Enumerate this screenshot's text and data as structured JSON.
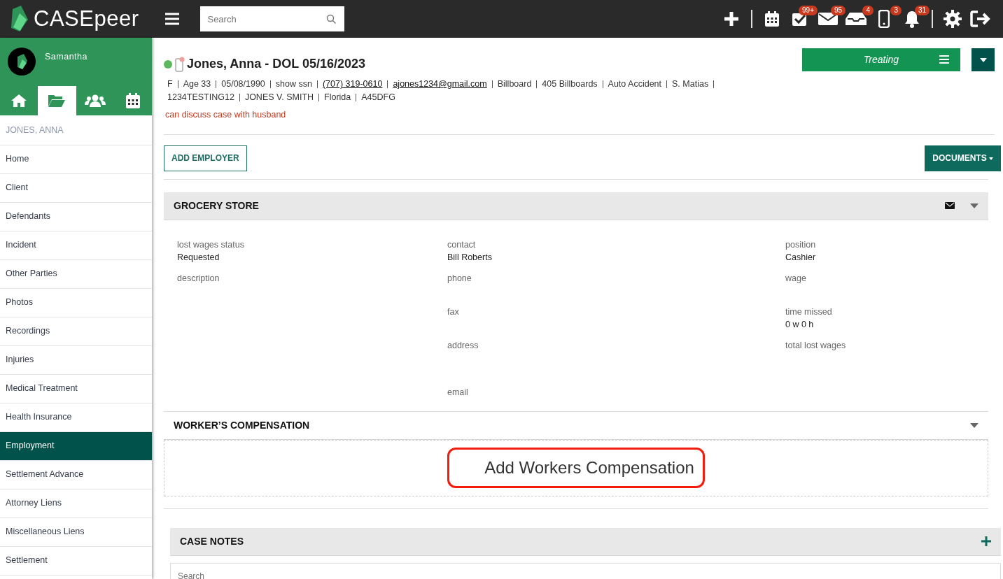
{
  "topbar": {
    "logo_text": "CASEpeer",
    "search_placeholder": "Search",
    "icons": [
      {
        "kind": "plus"
      },
      {
        "kind": "separator"
      },
      {
        "kind": "calendar"
      },
      {
        "kind": "tasks",
        "badge": "99+"
      },
      {
        "kind": "mail",
        "badge": "95"
      },
      {
        "kind": "inbox",
        "badge": "4"
      },
      {
        "kind": "phone",
        "badge": "3"
      },
      {
        "kind": "bell",
        "badge": "31"
      },
      {
        "kind": "separator"
      },
      {
        "kind": "gear"
      },
      {
        "kind": "logout"
      }
    ]
  },
  "user": {
    "name": "Samantha"
  },
  "sidebar_tabs": [
    {
      "kind": "home",
      "selected": false
    },
    {
      "kind": "folder",
      "selected": true
    },
    {
      "kind": "people",
      "selected": false
    },
    {
      "kind": "calendar",
      "selected": false
    }
  ],
  "sidebar": {
    "heading": "JONES, ANNA",
    "items": [
      {
        "label": "Home",
        "selected": false
      },
      {
        "label": "Client",
        "selected": false
      },
      {
        "label": "Defendants",
        "selected": false
      },
      {
        "label": "Incident",
        "selected": false
      },
      {
        "label": "Other Parties",
        "selected": false
      },
      {
        "label": "Photos",
        "selected": false
      },
      {
        "label": "Recordings",
        "selected": false
      },
      {
        "label": "Injuries",
        "selected": false
      },
      {
        "label": "Medical Treatment",
        "selected": false
      },
      {
        "label": "Health Insurance",
        "selected": false
      },
      {
        "label": "Employment",
        "selected": true
      },
      {
        "label": "Settlement Advance",
        "selected": false
      },
      {
        "label": "Attorney Liens",
        "selected": false
      },
      {
        "label": "Miscellaneous Liens",
        "selected": false
      },
      {
        "label": "Settlement",
        "selected": false
      }
    ]
  },
  "case": {
    "title": "Jones, Anna - DOL 05/16/2023",
    "detail_lines": [
      [
        {
          "text": "F",
          "kind": "text"
        },
        {
          "text": "Age 33",
          "kind": "text"
        },
        {
          "text": "05/08/1990",
          "kind": "text"
        },
        {
          "text": "show ssn",
          "kind": "text"
        },
        {
          "text": "(707) 319-0610",
          "kind": "link"
        },
        {
          "text": "ajones1234@gmail.com",
          "kind": "link"
        },
        {
          "text": "Billboard",
          "kind": "text"
        },
        {
          "text": "405 Billboards",
          "kind": "text"
        },
        {
          "text": "Auto Accident",
          "kind": "text"
        },
        {
          "text": "S. Matias",
          "kind": "text"
        }
      ],
      [
        {
          "text": "1234TESTING12",
          "kind": "text"
        },
        {
          "text": "JONES V. SMITH",
          "kind": "text"
        },
        {
          "text": "Florida",
          "kind": "text"
        },
        {
          "text": "A45DFG",
          "kind": "text"
        }
      ]
    ],
    "note": "can discuss case with husband",
    "status_label": "Treating"
  },
  "actions": {
    "add_employer": "ADD EMPLOYER",
    "documents": "DOCUMENTS"
  },
  "employer": {
    "name": "GROCERY STORE",
    "columns": [
      [
        {
          "label": "lost wages status",
          "value": "Requested"
        },
        {
          "label": "description"
        }
      ],
      [
        {
          "label": "contact",
          "value": "Bill Roberts"
        },
        {
          "label": "phone"
        },
        {
          "label": "fax"
        },
        {
          "label": "address",
          "kind": "multiline"
        },
        {
          "label": "email"
        }
      ],
      [
        {
          "label": "position",
          "value": "Cashier"
        },
        {
          "label": "wage"
        },
        {
          "label": "time missed",
          "value": "0 w 0 h"
        },
        {
          "label": "total lost wages"
        }
      ]
    ]
  },
  "workers_comp": {
    "title": "WORKER’S COMPENSATION",
    "add_label": "Add Workers Compensation",
    "highlighted": true
  },
  "case_notes": {
    "title": "CASE NOTES",
    "search_placeholder": "Search"
  }
}
